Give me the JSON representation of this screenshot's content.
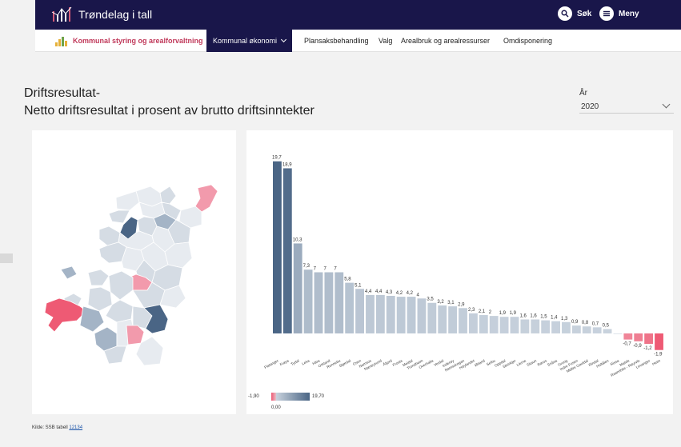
{
  "app": {
    "title": "Trøndelag i tall"
  },
  "topbar": {
    "search_label": "Søk",
    "menu_label": "Meny"
  },
  "nav": {
    "home_label": "Kommunal styring og arealforvaltning",
    "items": [
      {
        "label": "Kommunal økonomi",
        "active": true
      },
      {
        "label": "Plansaksbehandling",
        "active": false
      },
      {
        "label": "Valg",
        "active": false
      },
      {
        "label": "Arealbruk og arealressurser",
        "active": false
      },
      {
        "label": "Omdisponering",
        "active": false
      }
    ]
  },
  "page": {
    "title_line1": "Driftsresultat-",
    "title_line2": "Netto driftsresultat i prosent av brutto driftsinntekter"
  },
  "year_filter": {
    "label": "År",
    "value": "2020"
  },
  "chart_data": {
    "type": "bar",
    "categories": [
      "Flatanger",
      "Frøya",
      "Tydal",
      "Leka",
      "Hitra",
      "Orkland",
      "Rennebu",
      "Stjørdal",
      "Osen",
      "Namsos",
      "Nærøysund",
      "Åfjord",
      "Frosta",
      "Meldal",
      "Trondheim",
      "Overhalla",
      "Verdal",
      "Inderøy",
      "Namsskogan",
      "Høylandet",
      "Ørland",
      "Selbu",
      "Oppdal",
      "Steinkjer",
      "Lierne",
      "Skaun",
      "Røros",
      "Snåsa",
      "Grong",
      "Indre Fosen",
      "Midtre Gauldal",
      "Rindal",
      "Holtålen",
      "Rissa",
      "Malvik",
      "Raarvihke - Røyrvik",
      "Levanger",
      "Heim"
    ],
    "values": [
      19.7,
      18.9,
      10.3,
      7.3,
      7,
      7,
      7,
      5.8,
      5.1,
      4.4,
      4.4,
      4.3,
      4.2,
      4.2,
      4,
      3.5,
      3.2,
      3.1,
      2.9,
      2.3,
      2.1,
      2,
      1.9,
      1.9,
      1.6,
      1.6,
      1.5,
      1.4,
      1.3,
      0.9,
      0.8,
      0.7,
      0.5,
      0,
      -0.7,
      -0.9,
      -1.2,
      -1.9
    ],
    "labels": [
      "19,7",
      "18,9",
      "10,3",
      "7,3",
      "7",
      "7",
      "7",
      "5,8",
      "5,1",
      "4,4",
      "4,4",
      "4,3",
      "4,2",
      "4,2",
      "4",
      "3,5",
      "3,2",
      "3,1",
      "2,9",
      "2,3",
      "2,1",
      "2",
      "1,9",
      "1,9",
      "1,6",
      "1,6",
      "1,5",
      "1,4",
      "1,3",
      "0,9",
      "0,8",
      "0,7",
      "0,5",
      "",
      "-0,7",
      "-0,9",
      "-1,2",
      "-1,9"
    ],
    "ylim": [
      -2.2,
      20.5
    ],
    "legend": {
      "min_label": "-1,90",
      "mid_label": "0,00",
      "max_label": "19,70"
    },
    "colors": {
      "high": "#4a6585",
      "mid": "#c8d2dd",
      "low": "#ee5a74"
    }
  },
  "map": {
    "colors": {
      "dark": "#4a6585",
      "mid": "#a4b4c6",
      "light": "#d5dce4",
      "pale": "#e7ebf0",
      "pink": "#f29aac",
      "red": "#ee5a74"
    }
  },
  "footer": {
    "source_prefix": "Kilde: SSB tabell",
    "table_link": "12134"
  }
}
